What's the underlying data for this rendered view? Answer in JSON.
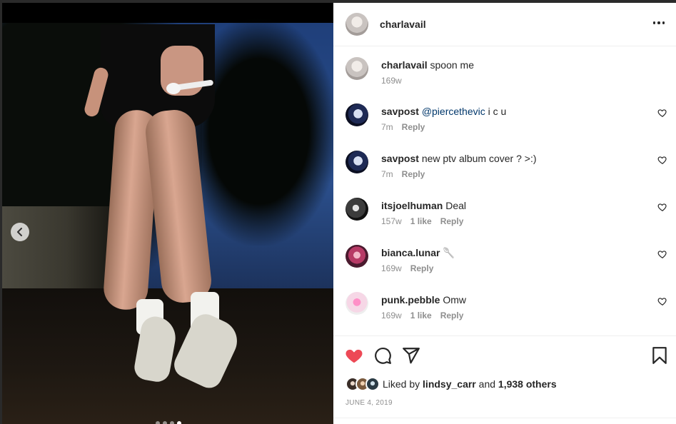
{
  "post": {
    "author": "charlavail",
    "caption": {
      "user": "charlavail",
      "text": "spoon me",
      "time": "169w"
    },
    "carousel": {
      "prev_icon": "chevron-left-icon",
      "dots": 4,
      "active_dot": 4
    }
  },
  "comments": [
    {
      "user": "savpost",
      "mention": "@piercethevic",
      "text": " i c u",
      "time": "7m",
      "likes": "",
      "reply": "Reply"
    },
    {
      "user": "savpost",
      "mention": "",
      "text": "new ptv album cover ? >:)",
      "time": "7m",
      "likes": "",
      "reply": "Reply"
    },
    {
      "user": "itsjoelhuman",
      "mention": "",
      "text": "Deal",
      "time": "157w",
      "likes": "1 like",
      "reply": "Reply"
    },
    {
      "user": "bianca.lunar",
      "mention": "",
      "text": "🥄",
      "time": "169w",
      "likes": "",
      "reply": "Reply"
    },
    {
      "user": "punk.pebble",
      "mention": "",
      "text": "Omw",
      "time": "169w",
      "likes": "1 like",
      "reply": "Reply"
    }
  ],
  "actions": {
    "like_icon": "heart-filled-icon",
    "comment_icon": "comment-icon",
    "share_icon": "paper-plane-icon",
    "save_icon": "bookmark-icon",
    "like_color": "#ed4956"
  },
  "likes": {
    "prefix": "Liked by",
    "first_user": "lindsy_carr",
    "and": "and",
    "others": "1,938 others"
  },
  "date": "JUNE 4, 2019"
}
